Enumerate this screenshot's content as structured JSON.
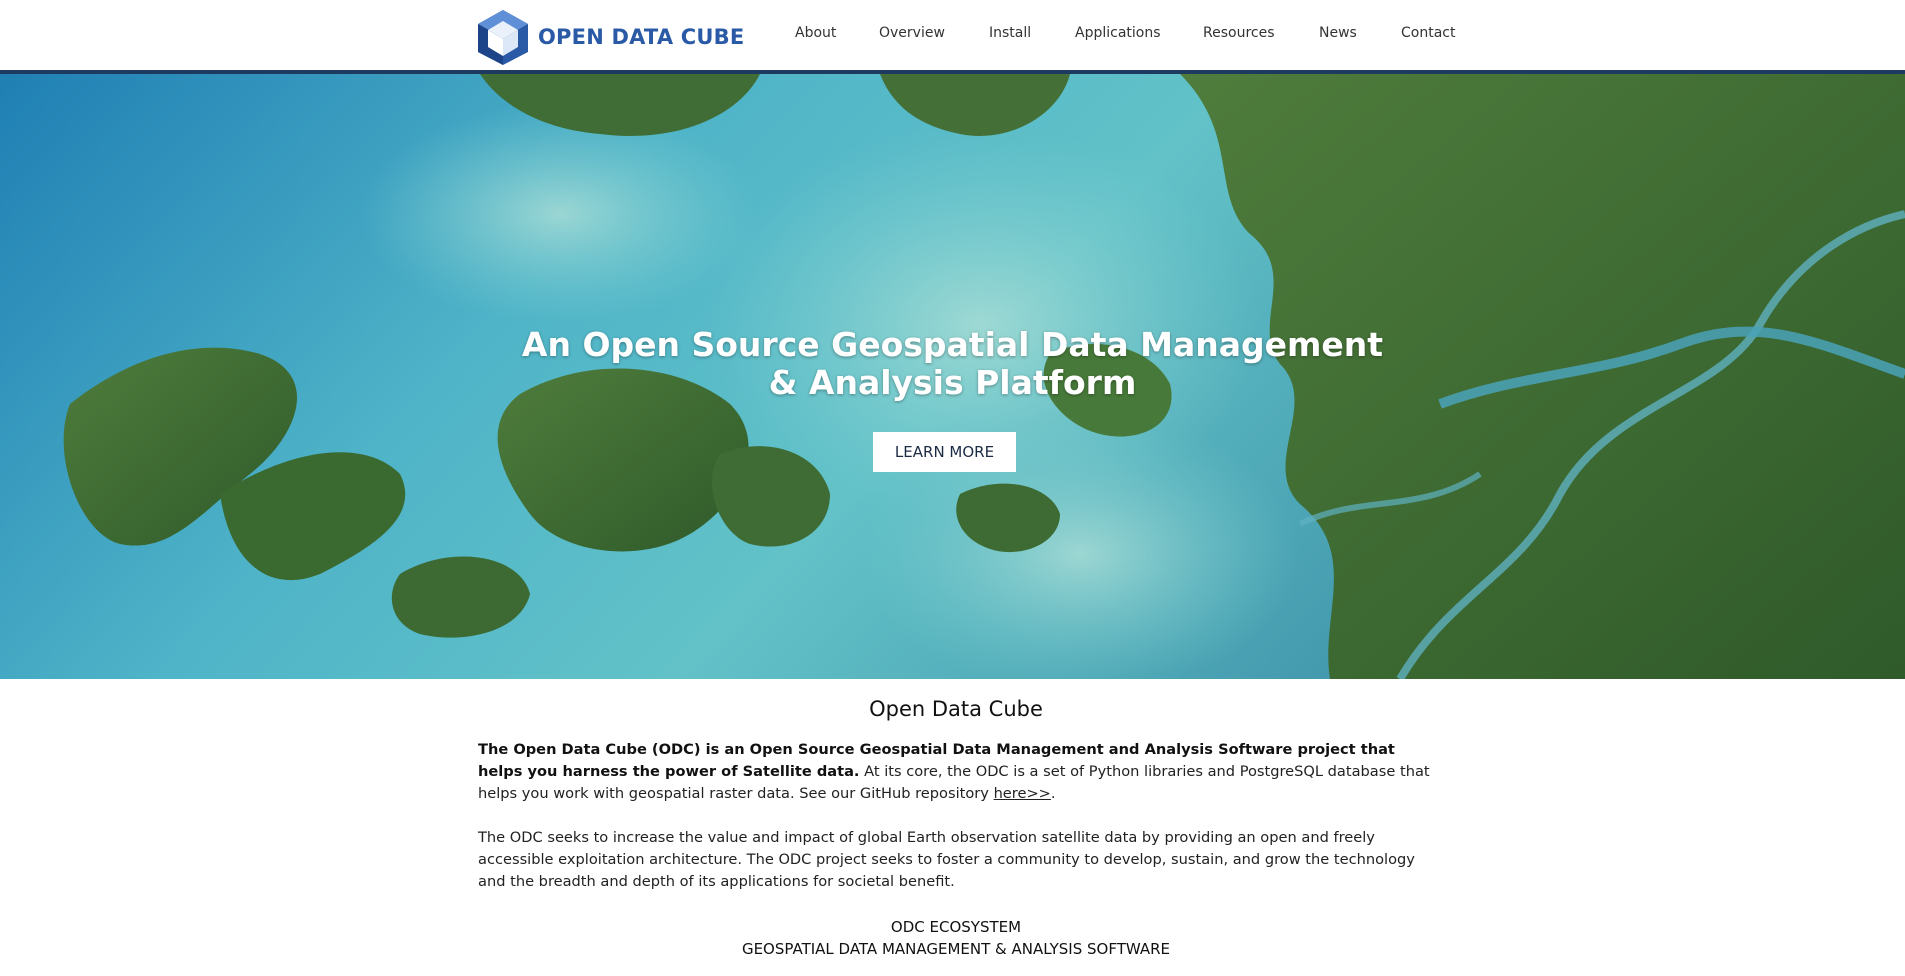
{
  "brand": {
    "name": "OPEN DATA CUBE",
    "color": "#2a5aa6"
  },
  "nav": {
    "items": [
      "About",
      "Overview",
      "Install",
      "Applications",
      "Resources",
      "News",
      "Contact"
    ]
  },
  "hero": {
    "title_line1": "An Open Source Geospatial Data Management",
    "title_line2": "& Analysis Platform",
    "cta_label": "LEARN MORE"
  },
  "intro": {
    "heading": "Open Data Cube",
    "p1_bold": "The Open Data Cube (ODC) is an Open Source Geospatial Data Management and Analysis Software project that helps you harness the power of Satellite data.",
    "p1_rest": " At its core, the ODC is a set of Python libraries and PostgreSQL database that helps you work with geospatial raster data. See our GitHub repository ",
    "p1_link": "here>>",
    "p1_end": ".",
    "p2": "The ODC seeks to increase the value and impact of global Earth observation satellite data by providing an open and freely accessible exploitation architecture. The ODC project seeks to foster a community to develop, sustain, and grow the technology and the breadth and depth of its applications for societal benefit."
  },
  "ecosystem": {
    "line1": "ODC ECOSYSTEM",
    "line2": "GEOSPATIAL DATA MANAGEMENT & ANALYSIS SOFTWARE"
  },
  "colors": {
    "header_rule": "#1f3a5f",
    "water": "#3d9cbf",
    "land": "#3f6a34"
  }
}
